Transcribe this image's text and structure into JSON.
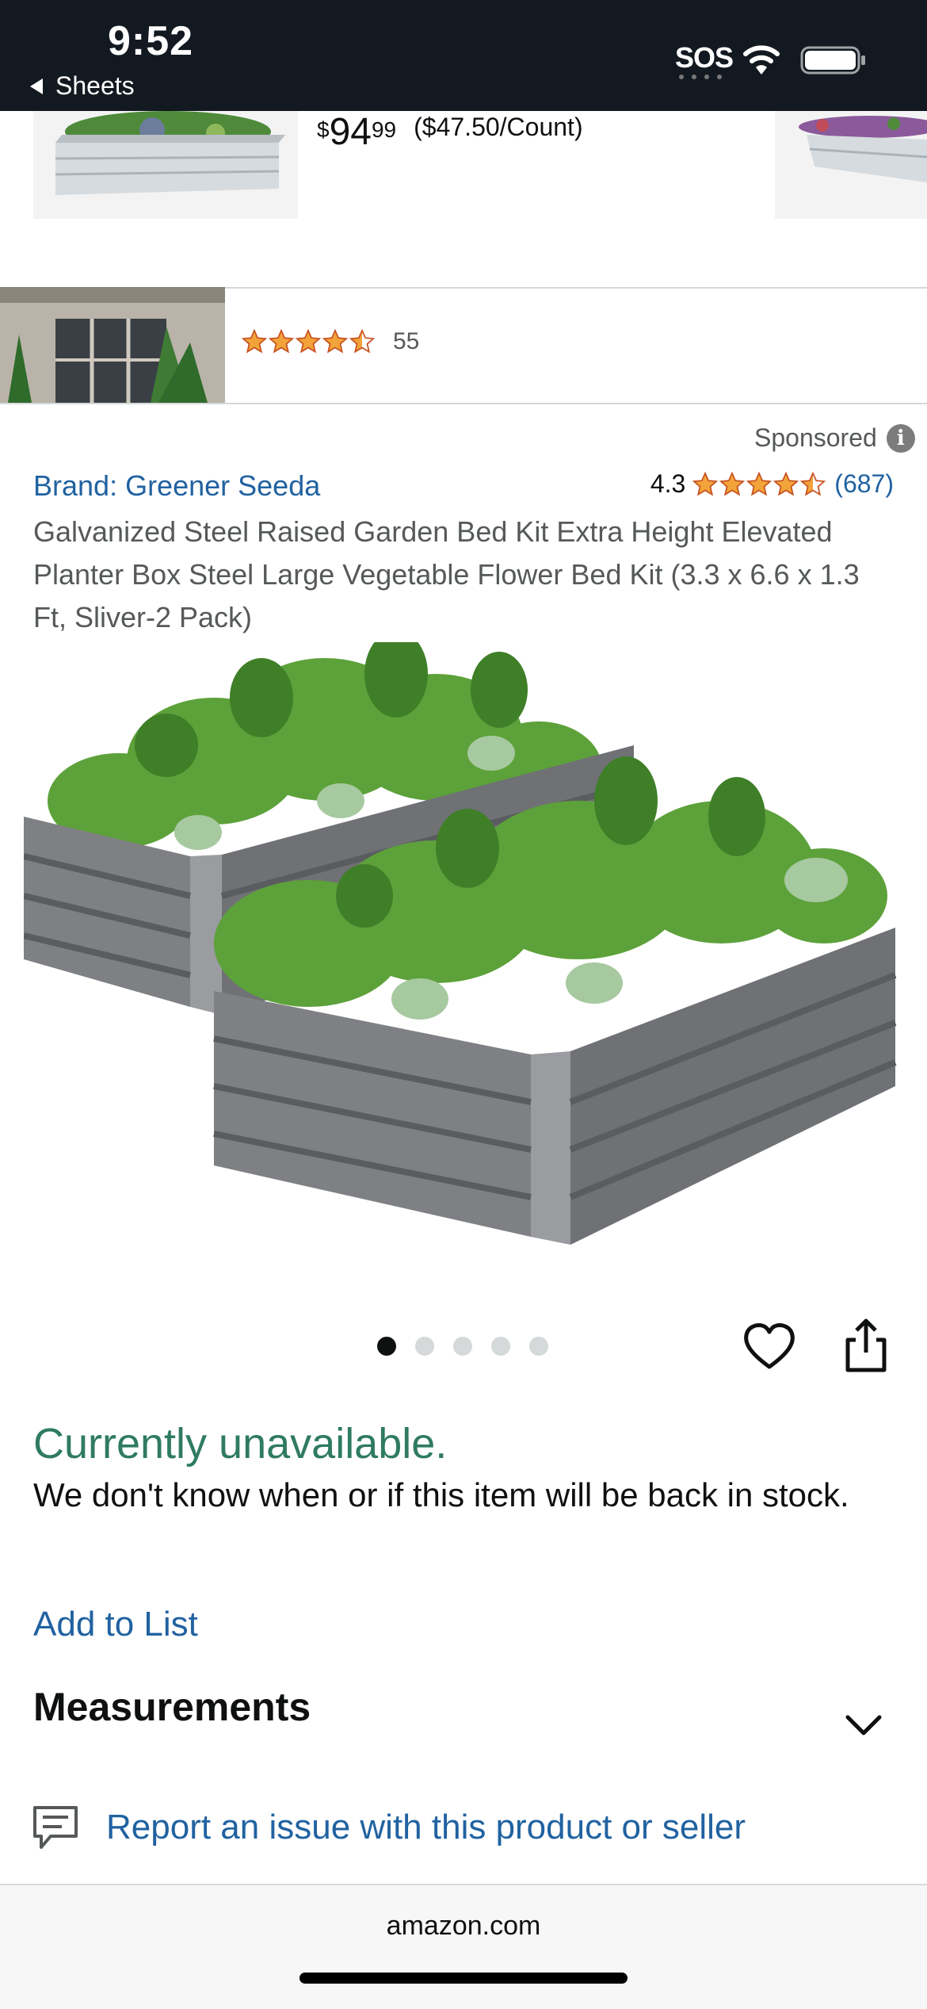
{
  "status_bar": {
    "time": "9:52",
    "back_label": "Sheets",
    "carrier": "SOS"
  },
  "carousel": {
    "price_symbol": "$",
    "price_whole": "94",
    "price_fraction": "99",
    "unit_price": "($47.50/Count)"
  },
  "review_strip": {
    "rating_stars": 4.5,
    "review_count": "55"
  },
  "ad": {
    "sponsored_label": "Sponsored",
    "info_glyph": "i",
    "brand": "Brand: Greener Seeda",
    "rating_value": "4.3",
    "rating_stars": 4.5,
    "rating_count": "(687)",
    "title": "Galvanized Steel Raised Garden Bed Kit Extra Height Elevated Planter Box Steel Large Vegetable Flower Bed Kit (3.3 x 6.6 x 1.3 Ft, Sliver-2 Pack)"
  },
  "gallery": {
    "image_count": 5,
    "active_index": 0
  },
  "availability": {
    "status": "Currently unavailable.",
    "message": "We don't know when or if this item will be back in stock."
  },
  "actions": {
    "add_to_list": "Add to List",
    "measurements": "Measurements",
    "report": "Report an issue with this product or seller"
  },
  "browser": {
    "domain": "amazon.com"
  },
  "colors": {
    "link": "#2162a1",
    "available_green": "#2f7b61",
    "star": "#f2a33a",
    "status_bar": "#131921"
  },
  "icons": [
    "back-triangle-icon",
    "wifi-icon",
    "battery-icon",
    "info-icon",
    "star-icon",
    "heart-icon",
    "share-icon",
    "chevron-down-icon",
    "report-icon"
  ]
}
